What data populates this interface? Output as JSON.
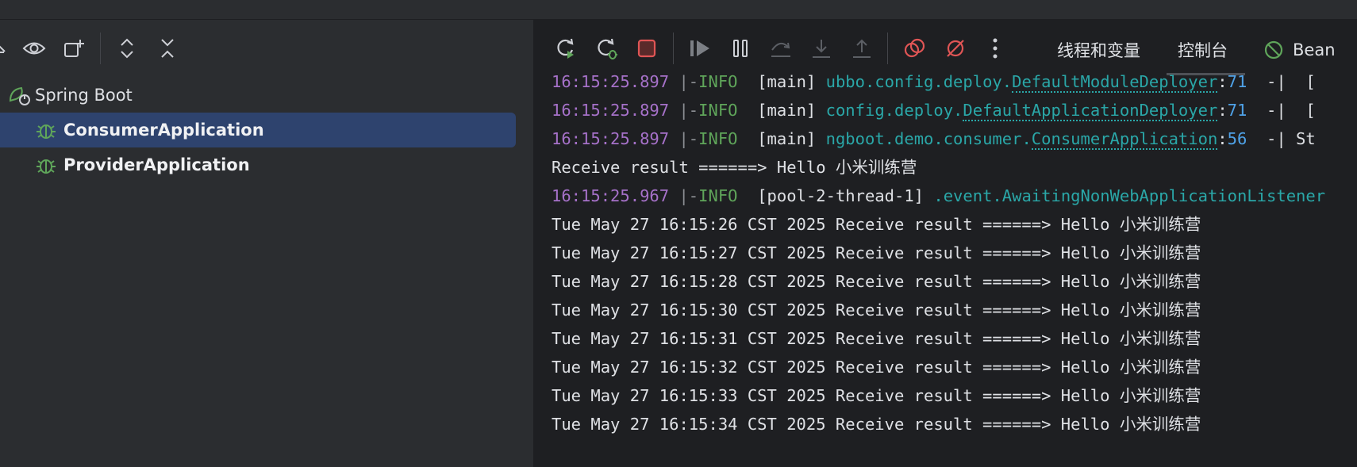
{
  "left_toolbar": {
    "icons": [
      "partial-chevron-icon",
      "eye-icon",
      "new-tab-icon",
      "expand-all-icon",
      "collapse-all-icon"
    ]
  },
  "tree": {
    "root": {
      "label": "Spring Boot",
      "icon": "spring-boot-icon"
    },
    "items": [
      {
        "label": "ConsumerApplication",
        "icon": "debug-bug-icon",
        "selected": true
      },
      {
        "label": "ProviderApplication",
        "icon": "debug-bug-icon",
        "selected": false
      }
    ]
  },
  "right_toolbar": {
    "icons": [
      "rerun-icon",
      "rerun-debug-icon",
      "stop-icon",
      "resume-icon",
      "pause-icon",
      "step-over-icon",
      "step-into-icon",
      "step-out-icon",
      "view-breakpoints-icon",
      "mute-breakpoints-icon",
      "more-icon"
    ],
    "tabs": [
      {
        "label": "线程和变量",
        "active": false
      },
      {
        "label": "控制台",
        "active": true
      },
      {
        "label": "Bean",
        "active": false,
        "icon": "disabled-circle-icon"
      }
    ]
  },
  "console": {
    "lines": [
      {
        "type": "log",
        "ts": "16:15:25.897",
        "sep": "|-",
        "level": "INFO",
        "thread": "[main]",
        "cls_prefix": "ubbo.config.deploy.",
        "cls_link": "DefaultModuleDeployer",
        "colon": ":",
        "lineno": "71",
        "tail": "  -|  ["
      },
      {
        "type": "log",
        "ts": "16:15:25.897",
        "sep": "|-",
        "level": "INFO",
        "thread": "[main]",
        "cls_prefix": "config.deploy.",
        "cls_link": "DefaultApplicationDeployer",
        "colon": ":",
        "lineno": "71",
        "tail": "  -|  ["
      },
      {
        "type": "log",
        "ts": "16:15:25.897",
        "sep": "|-",
        "level": "INFO",
        "thread": "[main]",
        "cls_prefix": "ngboot.demo.consumer.",
        "cls_link": "ConsumerApplication",
        "colon": ":",
        "lineno": "56",
        "tail": "  -| St"
      },
      {
        "type": "plain",
        "text": "Receive result ======> Hello 小米训练营"
      },
      {
        "type": "log2",
        "ts": "16:15:25.967",
        "sep": "|-",
        "level": "INFO",
        "thread": "[pool-2-thread-1]",
        "cls_prefix": ".event.AwaitingNonWebApplicationListener"
      },
      {
        "type": "plain",
        "text": "Tue May 27 16:15:26 CST 2025 Receive result ======> Hello 小米训练营"
      },
      {
        "type": "plain",
        "text": "Tue May 27 16:15:27 CST 2025 Receive result ======> Hello 小米训练营"
      },
      {
        "type": "plain",
        "text": "Tue May 27 16:15:28 CST 2025 Receive result ======> Hello 小米训练营"
      },
      {
        "type": "plain",
        "text": "Tue May 27 16:15:30 CST 2025 Receive result ======> Hello 小米训练营"
      },
      {
        "type": "plain",
        "text": "Tue May 27 16:15:31 CST 2025 Receive result ======> Hello 小米训练营"
      },
      {
        "type": "plain",
        "text": "Tue May 27 16:15:32 CST 2025 Receive result ======> Hello 小米训练营"
      },
      {
        "type": "plain",
        "text": "Tue May 27 16:15:33 CST 2025 Receive result ======> Hello 小米训练营"
      },
      {
        "type": "plain",
        "text": "Tue May 27 16:15:34 CST 2025 Receive result ======> Hello 小米训练营"
      }
    ]
  },
  "colors": {
    "timestamp": "#a671c9",
    "info": "#5fa55a",
    "class": "#2aa7a8",
    "lineno": "#4fa2e8",
    "selection": "#2e436e",
    "stop": "#e05555"
  }
}
